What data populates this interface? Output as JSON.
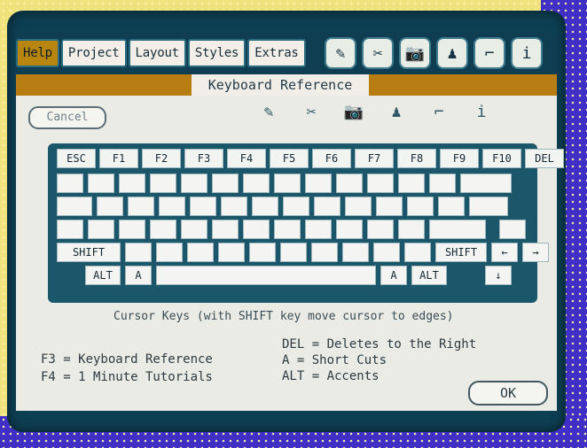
{
  "menu": {
    "items": [
      "Help",
      "Project",
      "Layout",
      "Styles",
      "Extras"
    ],
    "active": "Help"
  },
  "tools": [
    "pencil-icon",
    "scissors-icon",
    "camera-icon",
    "person-icon",
    "paint-roller-icon",
    "info-icon"
  ],
  "window": {
    "title": "Keyboard Reference",
    "cancel": "Cancel",
    "ok": "OK"
  },
  "keyboard": {
    "fn_keys": [
      "ESC",
      "F1",
      "F2",
      "F3",
      "F4",
      "F5",
      "F6",
      "F7",
      "F8",
      "F9",
      "F10",
      "DEL"
    ],
    "labels": {
      "shift_left": "SHIFT",
      "shift_right": "SHIFT",
      "alt_left": "ALT",
      "alt_right": "ALT",
      "a_left": "A",
      "a_right": "A"
    }
  },
  "cursor_hint": "Cursor Keys (with SHIFT key move cursor to edges)",
  "shortcuts_left": [
    "F3 = Keyboard Reference",
    "F4 = 1 Minute Tutorials"
  ],
  "shortcuts_right": [
    "DEL = Deletes to the Right",
    " A  = Short Cuts",
    "ALT = Accents"
  ]
}
